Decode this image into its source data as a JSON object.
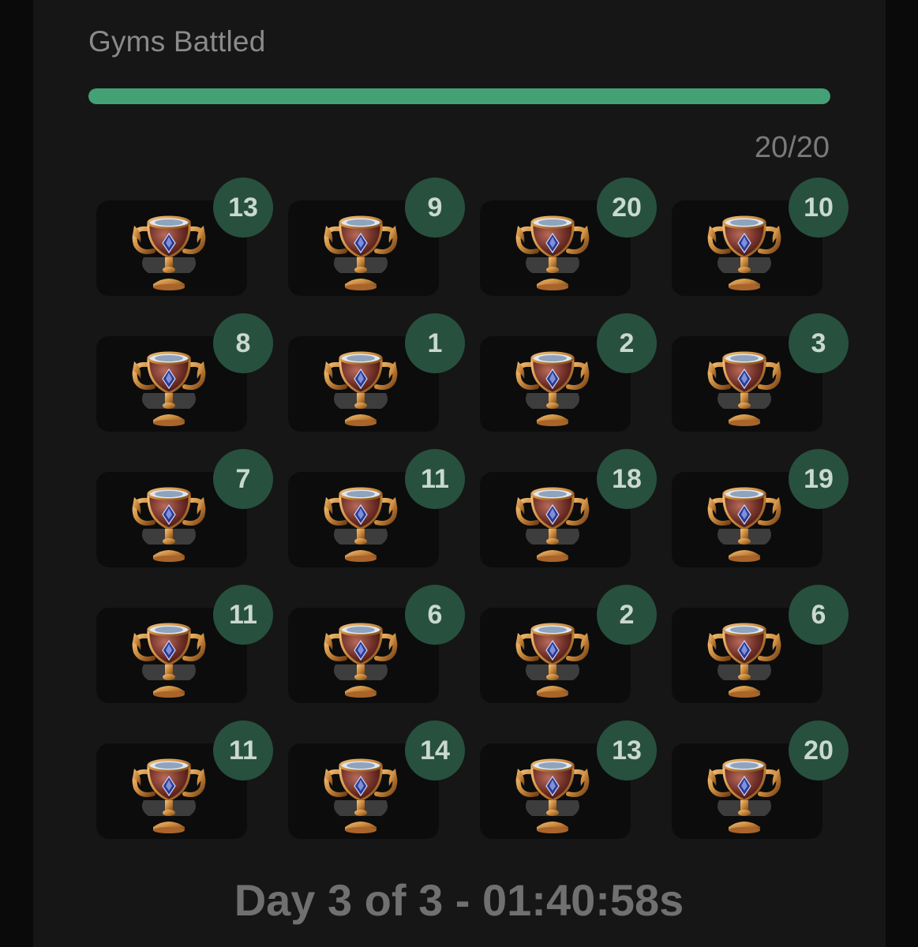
{
  "title": "Gyms Battled",
  "progress": {
    "done": 20,
    "total": 20,
    "fraction": 1.0,
    "label": "20/20"
  },
  "colors": {
    "accent": "#44a075",
    "badge": "#27503f",
    "trophy_gold": "#c8873a",
    "trophy_gem": "#2c3a8a"
  },
  "gyms": [
    {
      "count": "13",
      "icon": "trophy-icon"
    },
    {
      "count": "9",
      "icon": "trophy-icon"
    },
    {
      "count": "20",
      "icon": "trophy-icon"
    },
    {
      "count": "10",
      "icon": "trophy-icon"
    },
    {
      "count": "8",
      "icon": "trophy-icon"
    },
    {
      "count": "1",
      "icon": "trophy-icon"
    },
    {
      "count": "2",
      "icon": "trophy-icon"
    },
    {
      "count": "3",
      "icon": "trophy-icon"
    },
    {
      "count": "7",
      "icon": "trophy-icon"
    },
    {
      "count": "11",
      "icon": "trophy-icon"
    },
    {
      "count": "18",
      "icon": "trophy-icon"
    },
    {
      "count": "19",
      "icon": "trophy-icon"
    },
    {
      "count": "11",
      "icon": "trophy-icon"
    },
    {
      "count": "6",
      "icon": "trophy-icon"
    },
    {
      "count": "2",
      "icon": "trophy-icon"
    },
    {
      "count": "6",
      "icon": "trophy-icon"
    },
    {
      "count": "11",
      "icon": "trophy-icon"
    },
    {
      "count": "14",
      "icon": "trophy-icon"
    },
    {
      "count": "13",
      "icon": "trophy-icon"
    },
    {
      "count": "20",
      "icon": "trophy-icon"
    }
  ],
  "footer": "Day 3 of 3 - 01:40:58s"
}
